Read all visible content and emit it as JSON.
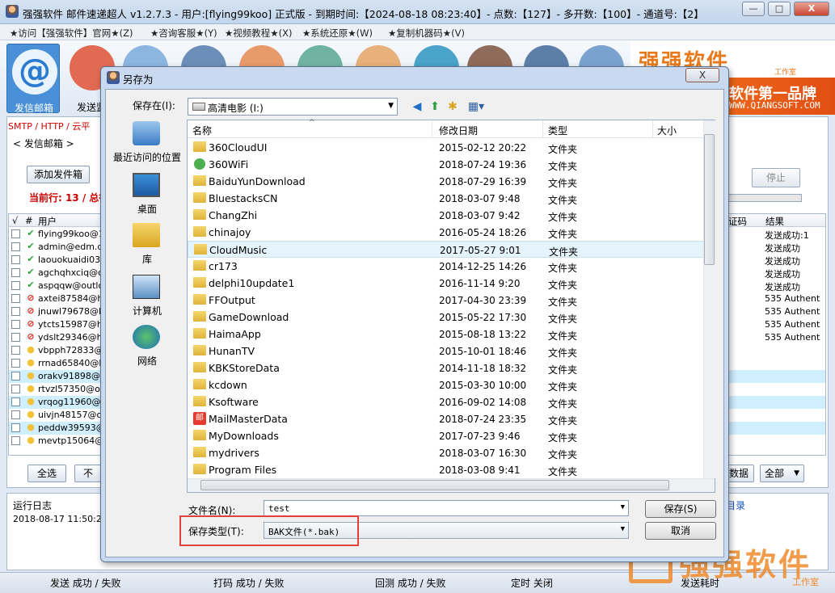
{
  "window": {
    "title": "强强软件 邮件速递超人 v1.2.7.3 - 用户:[flying99koo] 正式版 - 到期时间:【2024-08-18 08:23:40】- 点数:【127】- 多开数:【100】- 通道号:【2】",
    "min": "—",
    "max": "□",
    "close": "X"
  },
  "menu": [
    "★访问【强强软件】官网★(Z)",
    "★咨询客服★(Y)",
    "★视频教程★(X)",
    "★系统还原★(W)",
    "★复制机器码★(V)"
  ],
  "toolbar": {
    "send_label": "发信邮箱",
    "monitor_label": "发送监",
    "buttons": [
      {
        "color": "#e36a52"
      },
      {
        "color": "#8cb6e0"
      },
      {
        "color": "#6b8fb8"
      },
      {
        "color": "#e99a6a"
      },
      {
        "color": "#6fb3a5"
      },
      {
        "color": "#e8b07a"
      },
      {
        "color": "#4aa3c8"
      },
      {
        "color": "#8f6b5b"
      },
      {
        "color": "#5c7fa8"
      },
      {
        "color": "#7aa2cf"
      }
    ]
  },
  "brand": {
    "logo": "强强软件",
    "sub": "工作室",
    "slogan": "软件第一品牌",
    "site": "WWW.QIANGSOFT.COM"
  },
  "main": {
    "tabs": "SMTP / HTTP / 云平",
    "outbox": "< 发信邮箱 >",
    "add_btn": "添加发件箱",
    "current_line": "当前行: 13 / 总行",
    "stop_btn": "停止",
    "col_check": "√",
    "col_num": "#",
    "col_user": "用户",
    "col_code": "证码",
    "col_result": "结果",
    "rows": [
      {
        "email": "flying99koo@16",
        "status": "ok",
        "result": "发送成功:1"
      },
      {
        "email": "admin@edm.qian",
        "status": "ok",
        "result": "发送成功"
      },
      {
        "email": "laouokuaidi039@",
        "status": "ok",
        "result": "发送成功"
      },
      {
        "email": "agchqhxciq@ou",
        "status": "ok",
        "result": "发送成功"
      },
      {
        "email": "aspqqw@outlool",
        "status": "ok",
        "result": "发送成功"
      },
      {
        "email": "axtei87584@hot",
        "status": "ban",
        "result": "535 Authent"
      },
      {
        "email": "jnuwl79678@hot",
        "status": "ban",
        "result": "535 Authent"
      },
      {
        "email": "ytcts15987@hot",
        "status": "ban",
        "result": "535 Authent"
      },
      {
        "email": "ydslt29346@hot",
        "status": "ban",
        "result": "535 Authent"
      },
      {
        "email": "vbpph72833@ho",
        "status": "idle",
        "result": ""
      },
      {
        "email": "rrnad65840@ho",
        "status": "idle",
        "result": ""
      },
      {
        "email": "orakv91898@ho",
        "status": "idle",
        "result": ""
      },
      {
        "email": "rtvzl57350@outl",
        "status": "idle",
        "result": ""
      },
      {
        "email": "vrqog11960@ou",
        "status": "idle",
        "result": ""
      },
      {
        "email": "uivjn48157@out",
        "status": "idle",
        "result": ""
      },
      {
        "email": "peddw39593@ou",
        "status": "idle",
        "result": ""
      },
      {
        "email": "mevtp15064@ou",
        "status": "idle",
        "result": ""
      }
    ],
    "select_all": "全选",
    "select_none": "不选",
    "data_btn": "数据",
    "all_dropdown": "全部"
  },
  "log": {
    "title": "运行日志",
    "line": "2018-08-17 11:50:21 •",
    "dir_link": "目录"
  },
  "status": {
    "send": "发送 成功 / 失败",
    "code": "打码 成功 / 失败",
    "check": "回测 成功 / 失败",
    "timer": "定时 关闭",
    "elapsed": "发送耗时"
  },
  "watermark": {
    "text": "强强软件",
    "sub": "工作室"
  },
  "dialog": {
    "title": "另存为",
    "save_in_label": "保存在(I):",
    "save_in": "高清电影 (I:)",
    "close": "X",
    "places": [
      "最近访问的位置",
      "桌面",
      "库",
      "计算机",
      "网络"
    ],
    "headers": {
      "name": "名称",
      "date": "修改日期",
      "type": "类型",
      "size": "大小"
    },
    "files": [
      {
        "name": "360CloudUI",
        "date": "2015-02-12 20:22",
        "type": "文件夹",
        "icon": "folder"
      },
      {
        "name": "360WiFi",
        "date": "2018-07-24 19:36",
        "type": "文件夹",
        "icon": "wifi"
      },
      {
        "name": "BaiduYunDownload",
        "date": "2018-07-29 16:39",
        "type": "文件夹",
        "icon": "folder"
      },
      {
        "name": "BluestacksCN",
        "date": "2018-03-07 9:48",
        "type": "文件夹",
        "icon": "folder"
      },
      {
        "name": "ChangZhi",
        "date": "2018-03-07 9:42",
        "type": "文件夹",
        "icon": "folder"
      },
      {
        "name": "chinajoy",
        "date": "2016-05-24 18:26",
        "type": "文件夹",
        "icon": "folder"
      },
      {
        "name": "CloudMusic",
        "date": "2017-05-27 9:01",
        "type": "文件夹",
        "icon": "folder",
        "selected": true
      },
      {
        "name": "cr173",
        "date": "2014-12-25 14:26",
        "type": "文件夹",
        "icon": "folder"
      },
      {
        "name": "delphi10update1",
        "date": "2016-11-14 9:20",
        "type": "文件夹",
        "icon": "folder"
      },
      {
        "name": "FFOutput",
        "date": "2017-04-30 23:39",
        "type": "文件夹",
        "icon": "folder"
      },
      {
        "name": "GameDownload",
        "date": "2015-05-22 17:30",
        "type": "文件夹",
        "icon": "folder"
      },
      {
        "name": "HaimaApp",
        "date": "2015-08-18 13:22",
        "type": "文件夹",
        "icon": "folder"
      },
      {
        "name": "HunanTV",
        "date": "2015-10-01 18:46",
        "type": "文件夹",
        "icon": "folder"
      },
      {
        "name": "KBKStoreData",
        "date": "2014-11-18 18:32",
        "type": "文件夹",
        "icon": "folder"
      },
      {
        "name": "kcdown",
        "date": "2015-03-30 10:00",
        "type": "文件夹",
        "icon": "folder"
      },
      {
        "name": "Ksoftware",
        "date": "2016-09-02 14:08",
        "type": "文件夹",
        "icon": "folder"
      },
      {
        "name": "MailMasterData",
        "date": "2018-07-24 23:35",
        "type": "文件夹",
        "icon": "mail",
        "icon_text": "邮"
      },
      {
        "name": "MyDownloads",
        "date": "2017-07-23 9:46",
        "type": "文件夹",
        "icon": "folder"
      },
      {
        "name": "mydrivers",
        "date": "2018-03-07 16:30",
        "type": "文件夹",
        "icon": "folder"
      },
      {
        "name": "Program Files",
        "date": "2018-03-08 9:41",
        "type": "文件夹",
        "icon": "folder"
      }
    ],
    "filename_label": "文件名(N):",
    "filename": "test",
    "filetype_label": "保存类型(T):",
    "filetype": "BAK文件(*.bak)",
    "save_btn": "保存(S)",
    "cancel_btn": "取消"
  }
}
